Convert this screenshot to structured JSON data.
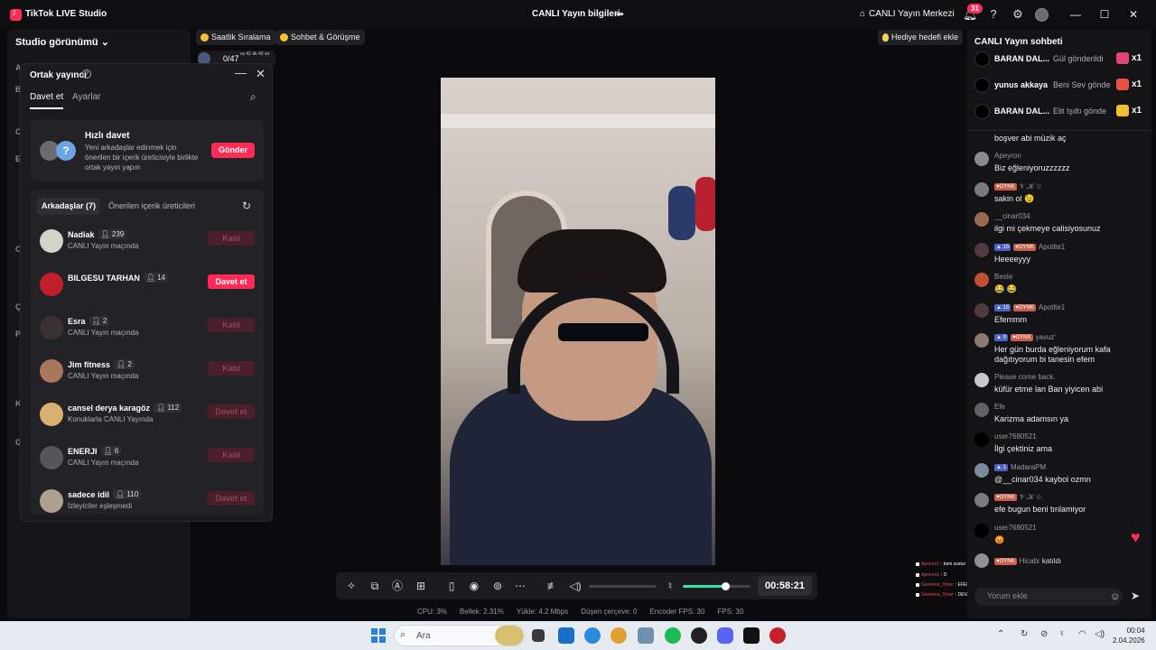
{
  "app": {
    "title": "TikTok LIVE Studio",
    "center_title": "CANLI Yayın bilgileri",
    "live_center": "CANLI Yayın Merkezi",
    "notification_count": "31",
    "accent_color": "#fe2c55"
  },
  "studio": {
    "header": "Studio görünümü",
    "letters": [
      "A",
      "B",
      "C",
      "E",
      "C",
      "Ç",
      "P",
      "K",
      "G"
    ]
  },
  "pills": {
    "hourly_ranking": "Saatlik Sıralama",
    "chat_meeting": "Sohbet & Görüşme",
    "gift_goal": "Hediye hedefi ekle",
    "timer_label": "0/47",
    "timer_sub": "ss 42 dk 40 sn"
  },
  "cohost": {
    "title": "Ortak yayıncı",
    "tabs": [
      "Davet et",
      "Ayarlar"
    ],
    "quick": {
      "title": "Hızlı davet",
      "desc": "Yeni arkadaşlar edinmek için önerilen bir içerik üreticisiyle birlikte ortak yayın yapın",
      "button": "Gönder"
    },
    "friend_tabs": [
      "Arkadaşlar (7)",
      "Önerilen içerik üreticileri"
    ],
    "friends": [
      {
        "name": "Nadiak",
        "count": "239",
        "status": "CANLI Yayın maçında",
        "button": "Katıl",
        "enabled": false,
        "color": "#cfd6c8"
      },
      {
        "name": "BILGESU TARHAN",
        "count": "14",
        "status": "",
        "button": "Davet et",
        "enabled": true,
        "color": "#c21f2c"
      },
      {
        "name": "Esra",
        "count": "2",
        "status": "CANLI Yayın maçında",
        "button": "Katıl",
        "enabled": false,
        "color": "#3a3230"
      },
      {
        "name": "Jim fitness",
        "count": "2",
        "status": "CANLI Yayın maçında",
        "button": "Katıl",
        "enabled": false,
        "color": "#a8785e"
      },
      {
        "name": "cansel derya karagöz",
        "count": "112",
        "status": "Konuklarla CANLI Yayında",
        "button": "Davet et",
        "enabled": false,
        "color": "#d8b070"
      },
      {
        "name": "ENERJI",
        "count": "6",
        "status": "CANLI Yayın maçında",
        "button": "Katıl",
        "enabled": false,
        "color": "#55555a"
      },
      {
        "name": "sadece idil",
        "count": "110",
        "status": "İzleyiciler eşleşmedi",
        "button": "Davet et",
        "enabled": false,
        "color": "#b0a090"
      }
    ]
  },
  "toolbar": {
    "time": "00:58:21",
    "mic_level": 0.62
  },
  "stats": {
    "cpu": "CPU: 3%",
    "memory": "Bellek: 2.31%",
    "upload": "Yükle: 4.2 Mbps",
    "dropped": "Düşen çerçeve: 0",
    "encoder_fps": "Encoder FPS: 30",
    "fps": "FPS: 30"
  },
  "mini_chat": [
    {
      "user": "Apeiron1",
      "text": ": beni sustur"
    },
    {
      "user": "Apeiron1",
      "text": ": D"
    },
    {
      "user": "Gavremir_Omer",
      "text": ": EFEM SAKİN KAL"
    },
    {
      "user": "Gavremir_Omer",
      "text": ": DEVAM"
    }
  ],
  "chat": {
    "title": "CANLI Yayın sohbeti",
    "gifts": [
      {
        "user": "BARAN DAL...",
        "msg": "Gül gönderildi",
        "count": "x1",
        "color": "#e0457a"
      },
      {
        "user": "yunus akkaya",
        "msg": "Beni Sev gönde",
        "count": "x1",
        "color": "#e85040"
      },
      {
        "user": "BARAN DAL...",
        "msg": "Elit Işıltı gönde",
        "count": "x1",
        "color": "#f0c030"
      }
    ],
    "messages": [
      {
        "user": "",
        "text": "boşver abi müzik aç",
        "level": "",
        "fan": "",
        "color": ""
      },
      {
        "user": "Apeyron",
        "text": "Biz eğleniyoruzzzzzz",
        "level": "",
        "fan": "",
        "color": "#8a8a90"
      },
      {
        "user": "𝒱.𝒦 ☆",
        "text": "sakin ol 😉",
        "level": "",
        "fan": "OYNK",
        "color": "#7a7a80"
      },
      {
        "user": "__cinar034",
        "text": "ilgi mi çekmeye calisiyosunuz",
        "level": "",
        "fan": "",
        "color": "#9a6a50"
      },
      {
        "user": "Apotlte1",
        "text": "Heeeeyyy",
        "level": "15",
        "fan": "OYNK",
        "color": "#503a40"
      },
      {
        "user": "Beste",
        "text": "😂 😂",
        "level": "",
        "fan": "",
        "color": "#c05030"
      },
      {
        "user": "Apotlte1",
        "text": "Efemmm",
        "level": "15",
        "fan": "OYNK",
        "color": "#503a40"
      },
      {
        "user": "yavuz'",
        "text": "Her gün burda eğleniyorum kafa dağıtıyorum bi tanesin efem",
        "level": "9",
        "fan": "OYNK",
        "color": "#8a7a70"
      },
      {
        "user": "Please come back.",
        "text": "küfür etme lan Ban yiyicen abi",
        "level": "",
        "fan": "",
        "color": "#c8c8cc"
      },
      {
        "user": "Efe",
        "text": "Karizma adamsın ya",
        "level": "",
        "fan": "",
        "color": "#606066"
      },
      {
        "user": "user7680521",
        "text": "İlgi çektiniz ama",
        "level": "",
        "fan": "",
        "color": "#000000"
      },
      {
        "user": "MadaraPM",
        "text": "@__cinar034 kaybol ozmn",
        "level": "1",
        "fan": "",
        "color": "#7a8a9a"
      },
      {
        "user": "𝒱.𝒦 ☆",
        "text": "efe bugun beni tınlamiyor",
        "level": "",
        "fan": "OYNK",
        "color": "#7a7a80"
      },
      {
        "user": "user7680521",
        "text": "😡",
        "level": "",
        "fan": "",
        "color": "#000000"
      },
      {
        "user": "Hicabi",
        "text": "katıldı",
        "level": "",
        "fan": "OYNK",
        "color": "#909096"
      }
    ],
    "input_placeholder": "Yorum ekle"
  },
  "taskbar": {
    "search_placeholder": "Ara",
    "time": "00:04",
    "date": "2.04.2026"
  }
}
